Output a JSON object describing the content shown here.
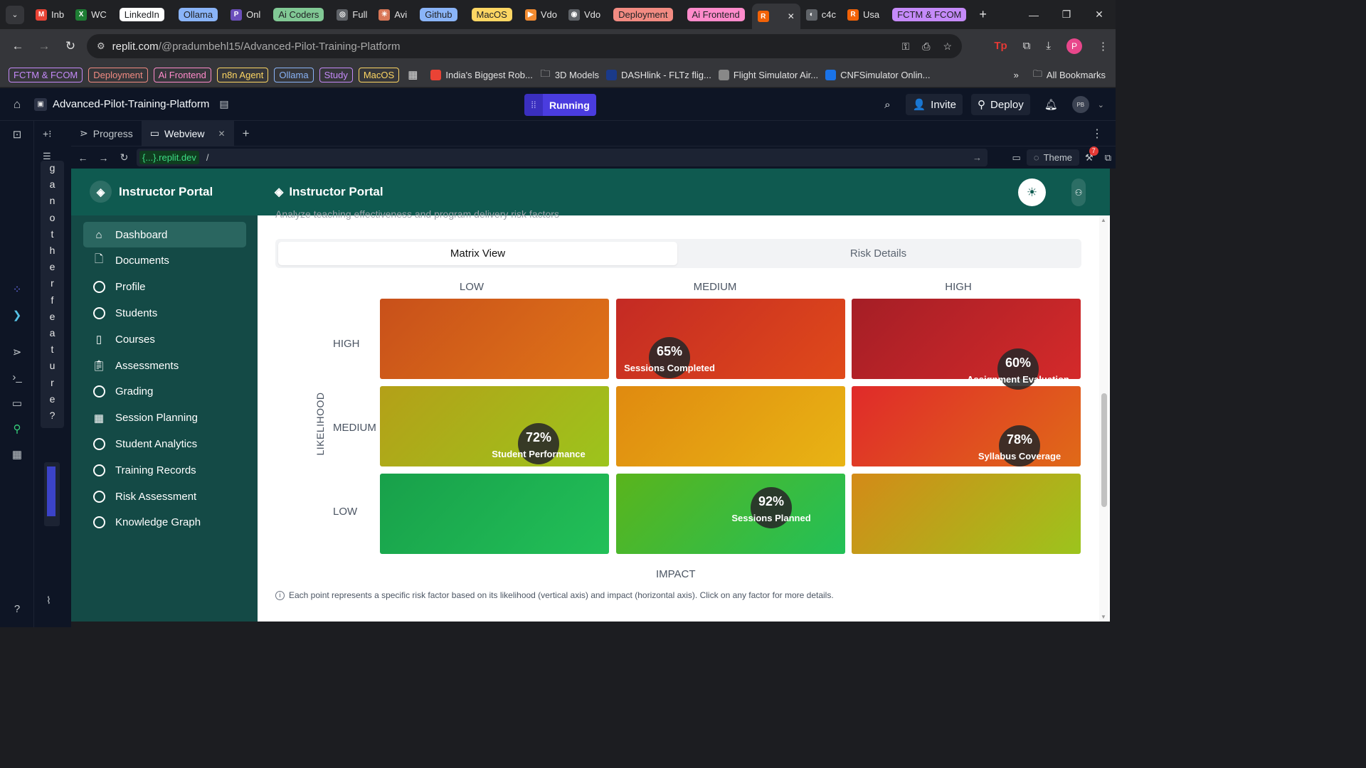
{
  "browser": {
    "tabs": [
      {
        "label": "Inb",
        "color": "#ea4335",
        "icon": "M"
      },
      {
        "label": "WC",
        "color": "#1e7e34",
        "icon": "X"
      },
      {
        "label": "LinkedIn",
        "group": true,
        "bg": "#ffffff",
        "fg": "#202124"
      },
      {
        "label": "Ollama",
        "group": true,
        "bg": "#8ab4f8",
        "fg": "#202124"
      },
      {
        "label": "Onl",
        "color": "#6b4fbb",
        "icon": "P"
      },
      {
        "label": "Ai Coders",
        "group": true,
        "bg": "#81c995",
        "fg": "#202124"
      },
      {
        "label": "Full",
        "color": "#5f6368",
        "icon": "◎"
      },
      {
        "label": "Avi",
        "color": "#d97757",
        "icon": "✳"
      },
      {
        "label": "Github",
        "group": true,
        "bg": "#8ab4f8",
        "fg": "#202124"
      },
      {
        "label": "MacOS",
        "group": true,
        "bg": "#fdd663",
        "fg": "#202124"
      },
      {
        "label": "Vdo",
        "color": "#f28b30",
        "icon": "▶"
      },
      {
        "label": "Vdo",
        "color": "#5f6368",
        "icon": "◉"
      },
      {
        "label": "Deployment",
        "group": true,
        "bg": "#f28b82",
        "fg": "#202124"
      },
      {
        "label": "Ai Frontend",
        "group": true,
        "bg": "#ff8bcb",
        "fg": "#202124"
      },
      {
        "label": "",
        "active": true,
        "color": "#f26207",
        "icon": "R"
      },
      {
        "label": "c4c",
        "color": "#5f6368",
        "icon": "◐"
      },
      {
        "label": "Usa",
        "color": "#f26207",
        "icon": "R"
      },
      {
        "label": "FCTM & FCOM",
        "group": true,
        "bg": "#c58af9",
        "fg": "#202124"
      }
    ],
    "url_host": "replit.com",
    "url_path": "/@pradumbehl15/Advanced-Pilot-Training-Platform",
    "bookmark_groups": [
      {
        "label": "FCTM & FCOM",
        "color": "#c58af9"
      },
      {
        "label": "Deployment",
        "color": "#f28b82"
      },
      {
        "label": "Ai Frontend",
        "color": "#ff8bcb"
      },
      {
        "label": "n8n Agent",
        "color": "#fdd663"
      },
      {
        "label": "Ollama",
        "color": "#8ab4f8"
      },
      {
        "label": "Study",
        "color": "#c58af9"
      },
      {
        "label": "MacOS",
        "color": "#fdd663"
      }
    ],
    "bookmarks": [
      {
        "label": "India's Biggest Rob...",
        "icon_color": "#ea4335"
      },
      {
        "label": "3D Models",
        "icon_color": "folder"
      },
      {
        "label": "DASHlink - FLTz flig...",
        "icon_color": "#1a3a8a"
      },
      {
        "label": "Flight Simulator Air...",
        "icon_color": "#888888"
      },
      {
        "label": "CNFSimulator Onlin...",
        "icon_color": "#1a73e8"
      }
    ],
    "all_bookmarks": "All Bookmarks",
    "profile_initial": "P"
  },
  "replit": {
    "project_title": "Advanced-Pilot-Training-Platform",
    "run_status": "Running",
    "invite_label": "Invite",
    "deploy_label": "Deploy",
    "avatar_initials": "PB",
    "panel_tabs": [
      {
        "label": "Progress",
        "active": false
      },
      {
        "label": "Webview",
        "active": true
      }
    ],
    "webview_domain": "{...}.replit.dev",
    "webview_path": "/",
    "theme_label": "Theme",
    "notif_count": "7",
    "side_vertical_text": [
      "g",
      "a",
      "n",
      "o",
      "t",
      "h",
      "e",
      "r",
      "f",
      "e",
      "a",
      "t",
      "u",
      "r",
      "e",
      "?"
    ]
  },
  "app": {
    "brand": "Instructor Portal",
    "header_title": "Instructor Portal",
    "subtitle": "Analyze teaching effectiveness and program delivery risk factors",
    "nav": [
      {
        "label": "Dashboard",
        "icon": "home-icon",
        "active": true
      },
      {
        "label": "Documents",
        "icon": "document-icon",
        "active": false
      },
      {
        "label": "Profile",
        "icon": "circle-icon",
        "active": false
      },
      {
        "label": "Students",
        "icon": "circle-icon",
        "active": false
      },
      {
        "label": "Courses",
        "icon": "book-icon",
        "active": false
      },
      {
        "label": "Assessments",
        "icon": "clipboard-icon",
        "active": false
      },
      {
        "label": "Grading",
        "icon": "circle-icon",
        "active": false
      },
      {
        "label": "Session Planning",
        "icon": "calendar-icon",
        "active": false
      },
      {
        "label": "Student Analytics",
        "icon": "circle-icon",
        "active": false
      },
      {
        "label": "Training Records",
        "icon": "circle-icon",
        "active": false
      },
      {
        "label": "Risk Assessment",
        "icon": "circle-icon",
        "active": false
      },
      {
        "label": "Knowledge Graph",
        "icon": "circle-icon",
        "active": false
      }
    ],
    "view_tabs": {
      "matrix": "Matrix View",
      "details": "Risk Details"
    },
    "matrix": {
      "impact_levels": [
        "LOW",
        "MEDIUM",
        "HIGH"
      ],
      "likelihood_levels": [
        "HIGH",
        "MEDIUM",
        "LOW"
      ],
      "likelihood_axis": "LIKELIHOOD",
      "impact_axis": "IMPACT",
      "cell_gradients": [
        [
          "linear-gradient(135deg,#c8501a,#e07418)",
          "linear-gradient(135deg,#c42a24,#e04a1a)",
          "linear-gradient(135deg,#a51e26,#d42a2a)"
        ],
        [
          "linear-gradient(135deg,#b4a018,#9cc41c)",
          "linear-gradient(135deg,#e08a10,#e8b414)",
          "linear-gradient(135deg,#e02a2a,#e06a18)"
        ],
        [
          "linear-gradient(135deg,#18a04a,#22c058)",
          "linear-gradient(135deg,#5ab41c,#22c058)",
          "linear-gradient(135deg,#d48a18,#9cc41c)"
        ]
      ],
      "risk_factors": [
        {
          "value": "65%",
          "label": "Sessions Completed",
          "likelihood": "HIGH",
          "impact": "MEDIUM"
        },
        {
          "value": "60%",
          "label": "Assignment Evaluation",
          "likelihood": "HIGH",
          "impact": "HIGH"
        },
        {
          "value": "72%",
          "label": "Student Performance",
          "likelihood": "MEDIUM",
          "impact": "LOW"
        },
        {
          "value": "78%",
          "label": "Syllabus Coverage",
          "likelihood": "MEDIUM",
          "impact": "HIGH"
        },
        {
          "value": "92%",
          "label": "Sessions Planned",
          "likelihood": "LOW",
          "impact": "MEDIUM"
        }
      ]
    },
    "footnote": "Each point represents a specific risk factor based on its likelihood (vertical axis) and impact (horizontal axis). Click on any factor for more details."
  }
}
